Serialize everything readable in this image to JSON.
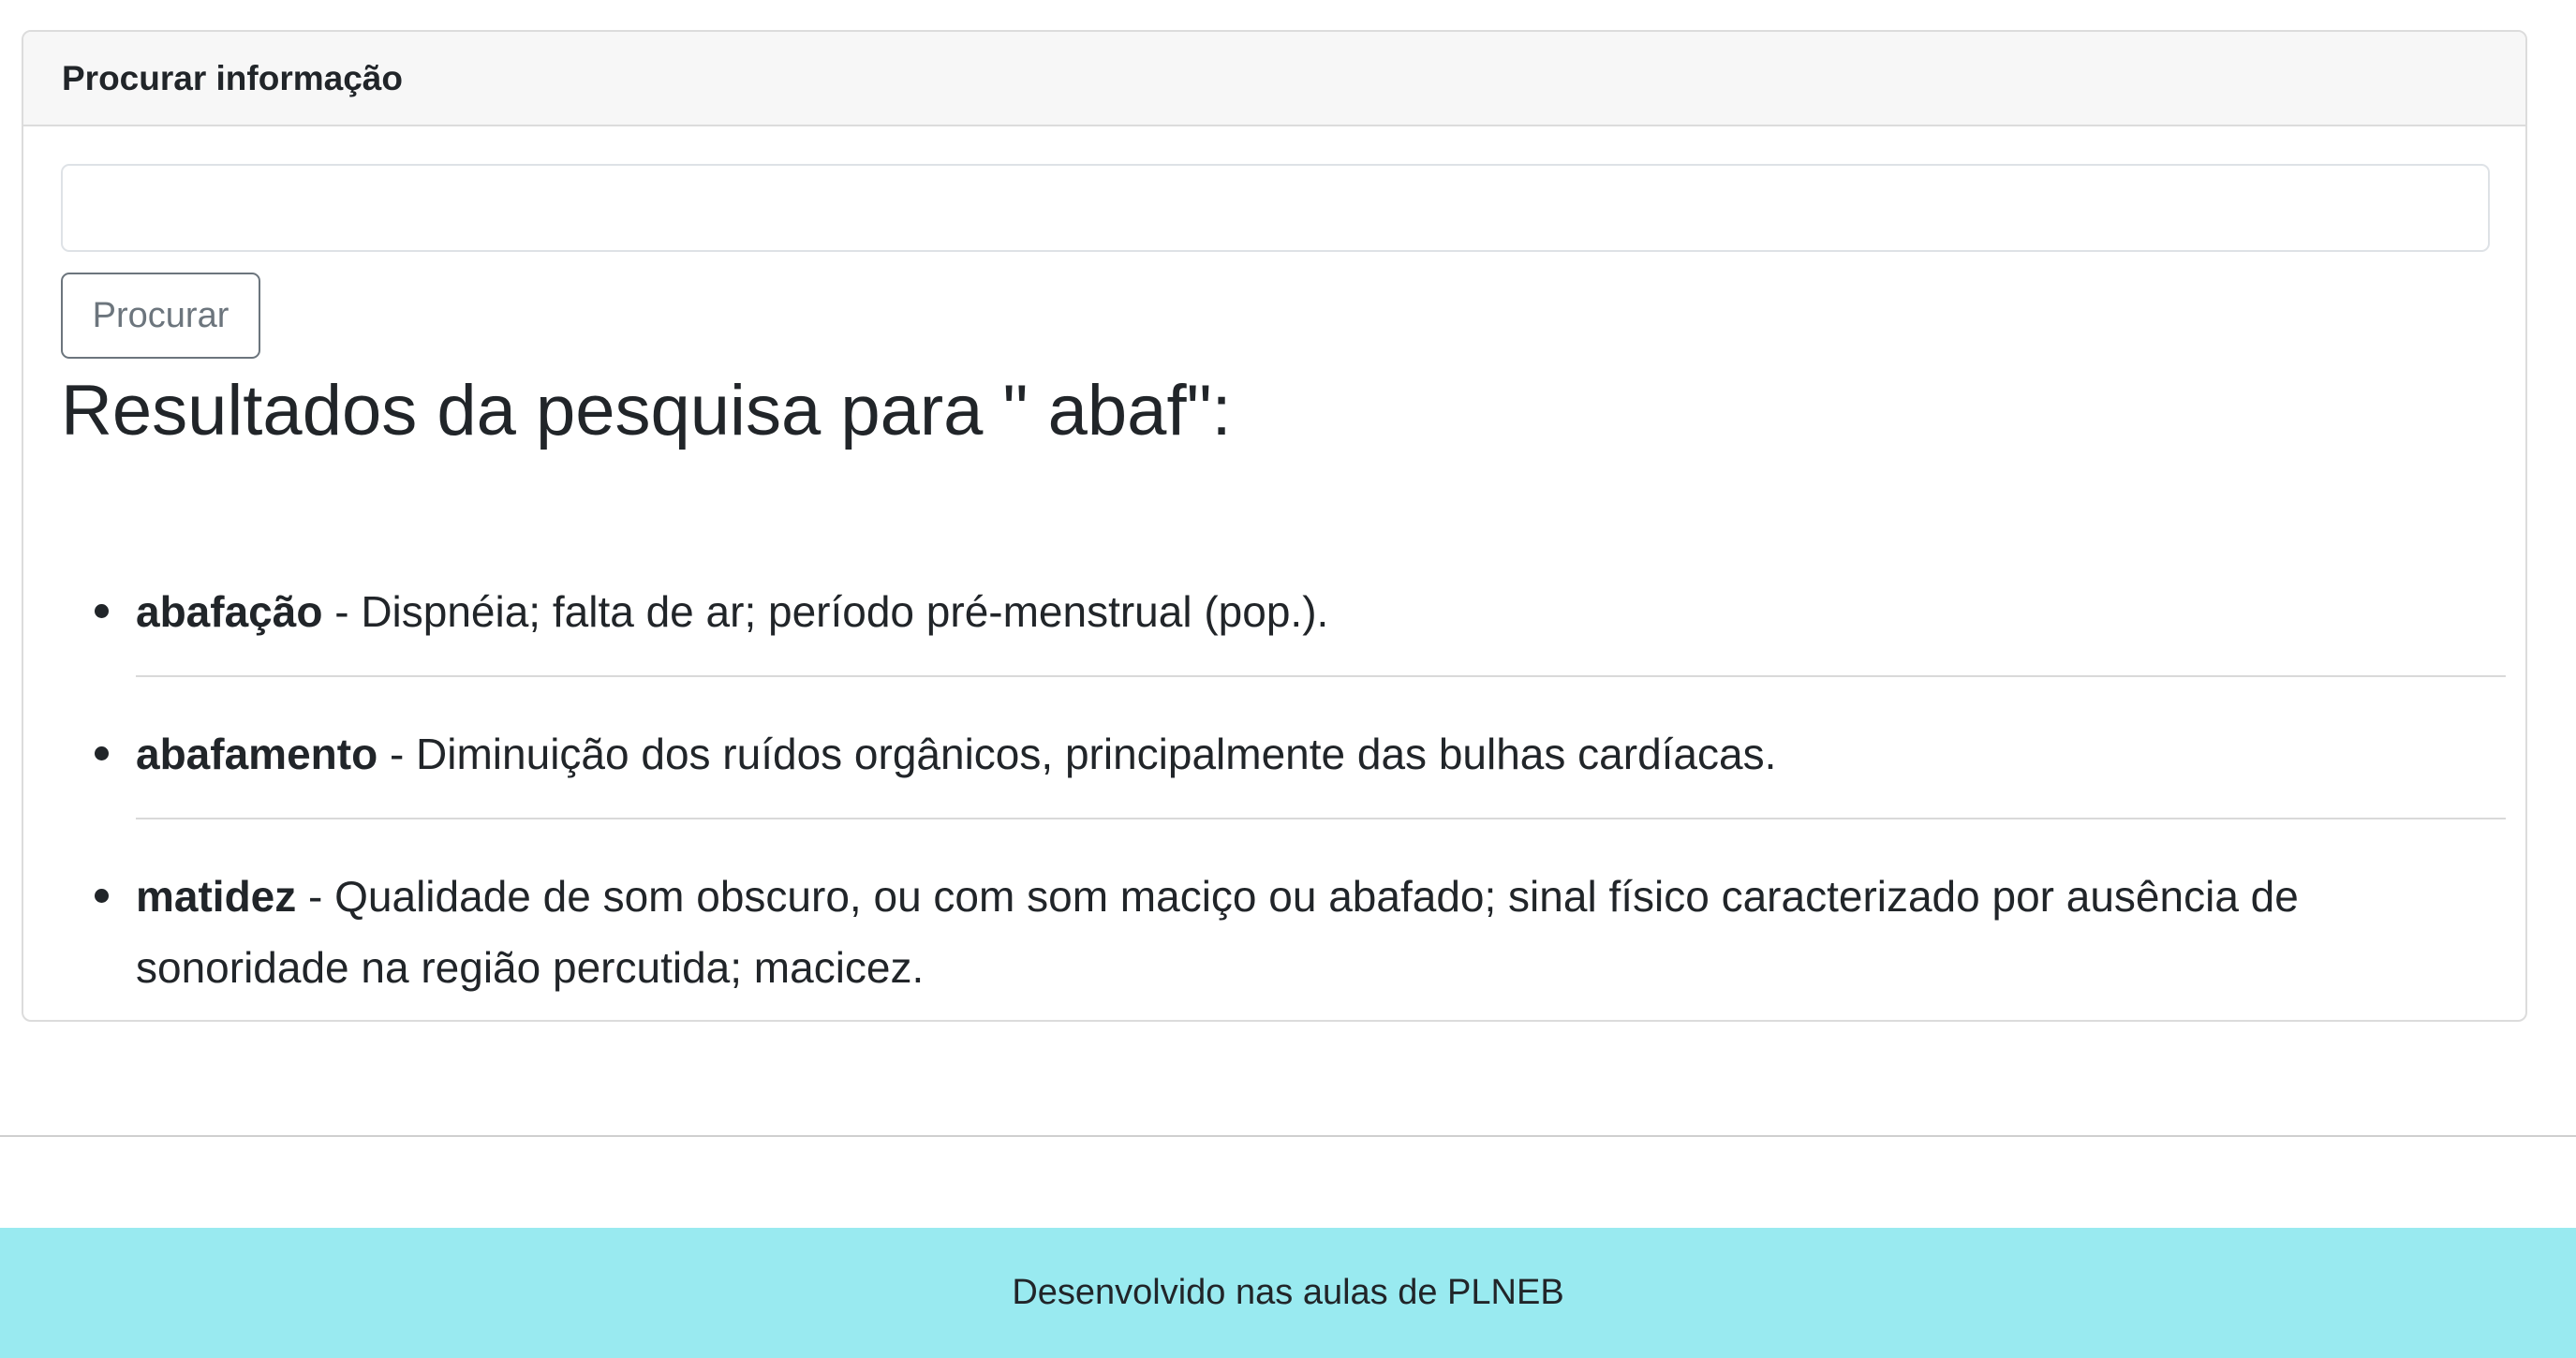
{
  "card": {
    "header_title": "Procurar informação"
  },
  "search": {
    "value": "",
    "placeholder": "",
    "button_label": "Procurar"
  },
  "results": {
    "heading": "Resultados da pesquisa para \" abaf\":",
    "items": [
      {
        "term": "abafação",
        "definition": " - Dispnéia; falta de ar; período pré-menstrual (pop.)."
      },
      {
        "term": "abafamento",
        "definition": " - Diminuição dos ruídos orgânicos, principalmente das bulhas cardíacas."
      },
      {
        "term": "matidez",
        "definition": " - Qualidade de som obscuro, ou com som maciço ou abafado; sinal físico caracterizado por ausência de sonoridade na região percutida; macicez."
      }
    ]
  },
  "footer": {
    "text": "Desenvolvido nas aulas de PLNEB"
  },
  "colors": {
    "footer_background": "#99eaf0",
    "card_header_background": "#f7f7f7",
    "button_border": "#6c757d"
  }
}
